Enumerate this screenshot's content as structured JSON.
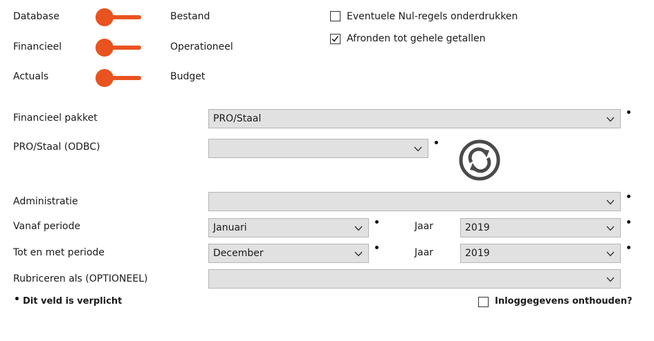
{
  "toggles": [
    {
      "left": "Database",
      "right": "Bestand"
    },
    {
      "left": "Financieel",
      "right": "Operationeel"
    },
    {
      "left": "Actuals",
      "right": "Budget"
    }
  ],
  "options": {
    "suppress_zero": {
      "label": "Eventuele Nul-regels onderdrukken",
      "checked": false
    },
    "round_integers": {
      "label": "Afronden tot gehele getallen",
      "checked": true
    }
  },
  "form": {
    "package": {
      "label": "Financieel pakket",
      "value": "PRO/Staal"
    },
    "odbc": {
      "label": "PRO/Staal (ODBC)",
      "value": ""
    },
    "administration": {
      "label": "Administratie",
      "value": ""
    },
    "from_period": {
      "label": "Vanaf periode",
      "value": "Januari",
      "year_label": "Jaar",
      "year_value": "2019"
    },
    "to_period": {
      "label": "Tot en met periode",
      "value": "December",
      "year_label": "Jaar",
      "year_value": "2019"
    },
    "classify": {
      "label": "Rubriceren als (OPTIONEEL)",
      "value": ""
    }
  },
  "footer": {
    "required_note": "Dit veld is verplicht",
    "remember_login": {
      "label": "Inloggegevens onthouden?",
      "checked": false
    }
  },
  "colors": {
    "accent": "#e9531f",
    "field_bg": "#e1e1e1",
    "icon": "#4a4a4a"
  },
  "icons": {
    "refresh": "refresh-icon",
    "dropdown": "chevron-down-icon"
  }
}
